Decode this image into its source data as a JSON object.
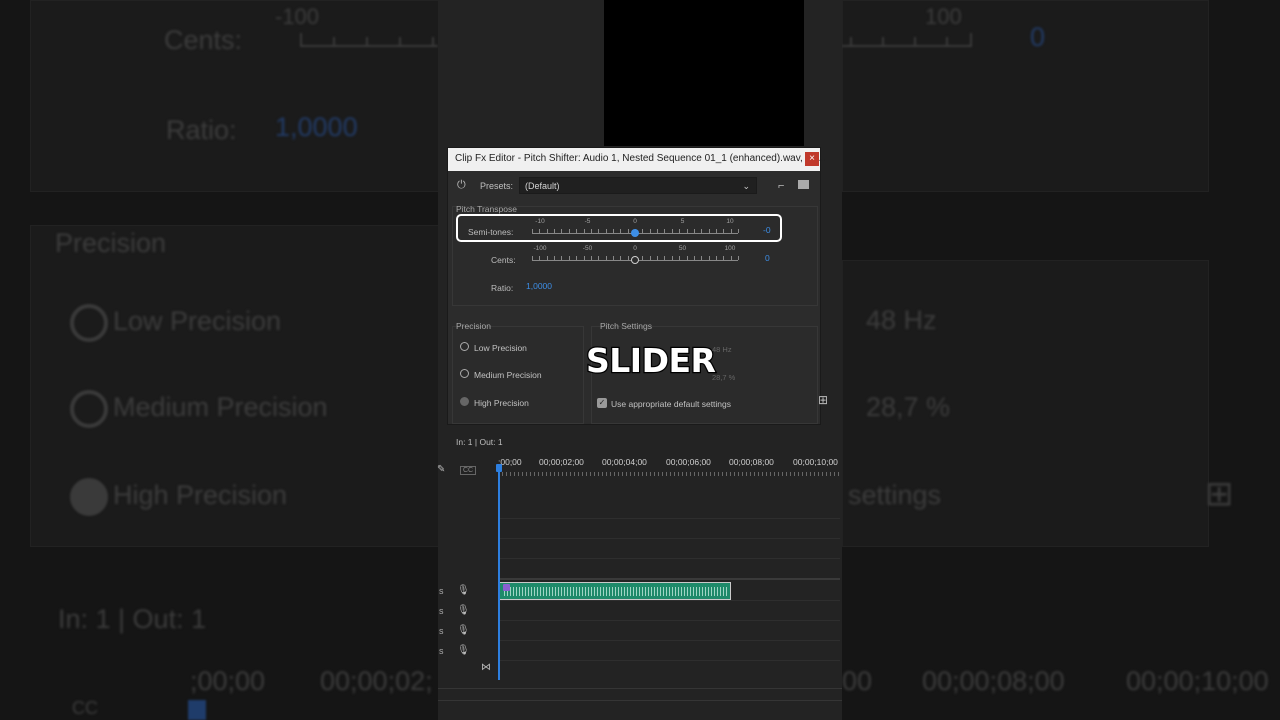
{
  "dialog": {
    "title": "Clip Fx Editor - Pitch Shifter: Audio 1, Nested Sequence 01_1 (enhanced).wav, Eff...",
    "close_label": "×",
    "presets_label": "Presets:",
    "preset_value": "(Default)"
  },
  "pitch_transpose": {
    "label": "Pitch Transpose",
    "semitones": {
      "label": "Semi-tones:",
      "value": "-0",
      "scale": [
        "-10",
        "-5",
        "0",
        "5",
        "10"
      ],
      "min": -12,
      "max": 12,
      "current": 0
    },
    "cents": {
      "label": "Cents:",
      "value": "0",
      "scale": [
        "-100",
        "-50",
        "0",
        "50",
        "100"
      ],
      "min": -100,
      "max": 100,
      "current": 0
    },
    "ratio": {
      "label": "Ratio:",
      "value": "1,0000"
    }
  },
  "precision": {
    "label": "Precision",
    "options": [
      "Low Precision",
      "Medium Precision",
      "High Precision"
    ],
    "selected": "High Precision"
  },
  "pitch_settings": {
    "label": "Pitch Settings",
    "frequency_value": "48 Hz",
    "overlap_value": "28,7 %",
    "checkbox_label": "Use appropriate default settings",
    "checked": true
  },
  "caption": "SLIDER",
  "timeline": {
    "inout": "In: 1 | Out: 1",
    "timecodes": [
      ";00;00",
      "00;00;02;00",
      "00;00;04;00",
      "00;00;06;00",
      "00;00;08;00",
      "00;00;10;00"
    ],
    "cc_label": "CC"
  },
  "background": {
    "cents": "Cents:",
    "ratio": "Ratio:",
    "ratio_value": "1,0000",
    "scale_left": "-100",
    "scale_right": "100",
    "cents_value": "0",
    "precision": "Precision",
    "low": "Low Precision",
    "medium": "Medium Precision",
    "high": "High Precision",
    "hz": "48 Hz",
    "pct": "28,7 %",
    "settings": "settings",
    "inout": "In: 1 | Out: 1",
    "tc1": ";00;00",
    "tc2": "00;00;02;",
    "tc3": "00",
    "tc4": "00;00;08;00",
    "tc5": "00;00;10;00",
    "cc": "CC"
  },
  "colors": {
    "accent": "#3d8ee6",
    "clip": "#1e8a6a",
    "playhead": "#2d7fe0"
  }
}
